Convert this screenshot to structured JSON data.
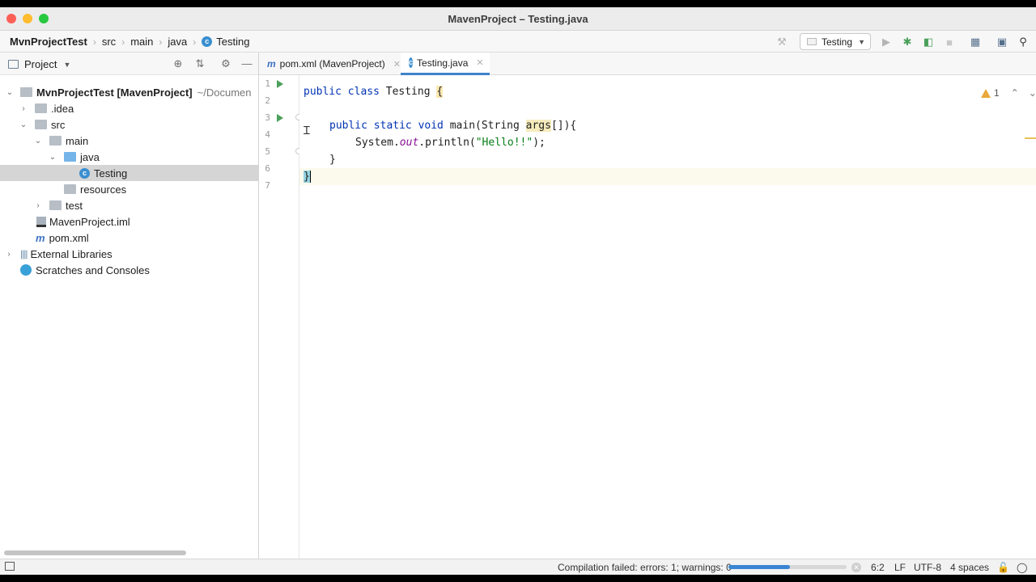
{
  "window": {
    "title": "MavenProject – Testing.java"
  },
  "breadcrumb": [
    "MvnProjectTest",
    "src",
    "main",
    "java",
    "Testing"
  ],
  "toolbar": {
    "run_config": "Testing"
  },
  "project_panel": {
    "title": "Project",
    "tree": [
      {
        "label": "MvnProjectTest [MavenProject]",
        "suffix": "~/Documen"
      },
      {
        "label": ".idea"
      },
      {
        "label": "src"
      },
      {
        "label": "main"
      },
      {
        "label": "java"
      },
      {
        "label": "Testing"
      },
      {
        "label": "resources"
      },
      {
        "label": "test"
      },
      {
        "label": "MavenProject.iml"
      },
      {
        "label": "pom.xml"
      },
      {
        "label": "External Libraries"
      },
      {
        "label": "Scratches and Consoles"
      }
    ]
  },
  "editor": {
    "tabs": [
      {
        "label": "pom.xml (MavenProject)",
        "icon": "m"
      },
      {
        "label": "Testing.java",
        "icon": "c"
      }
    ],
    "line_numbers": [
      "1",
      "2",
      "3",
      "4",
      "5",
      "6",
      "7"
    ],
    "code": {
      "l1_kw": "public class",
      "l1_name": " Testing ",
      "l1_brace": "{",
      "l3_kw": "public static void",
      "l3_rest1": " main(String ",
      "l3_args": "args",
      "l3_rest2": "[]){",
      "l4_a": "System.",
      "l4_out": "out",
      "l4_b": ".println(",
      "l4_str": "\"Hello!!\"",
      "l4_c": ");",
      "l5": "}",
      "l6": "}"
    },
    "warnings": {
      "count": "1"
    }
  },
  "status_bar": {
    "message": "Compilation failed: errors: 1; warnings: 0",
    "progress": 0.52,
    "position": "6:2",
    "line_sep": "LF",
    "encoding": "UTF-8",
    "indent": "4 spaces"
  },
  "colors": {
    "accent": "#4083c9",
    "run_green": "#4aa05a",
    "warning": "#e8a93a"
  }
}
